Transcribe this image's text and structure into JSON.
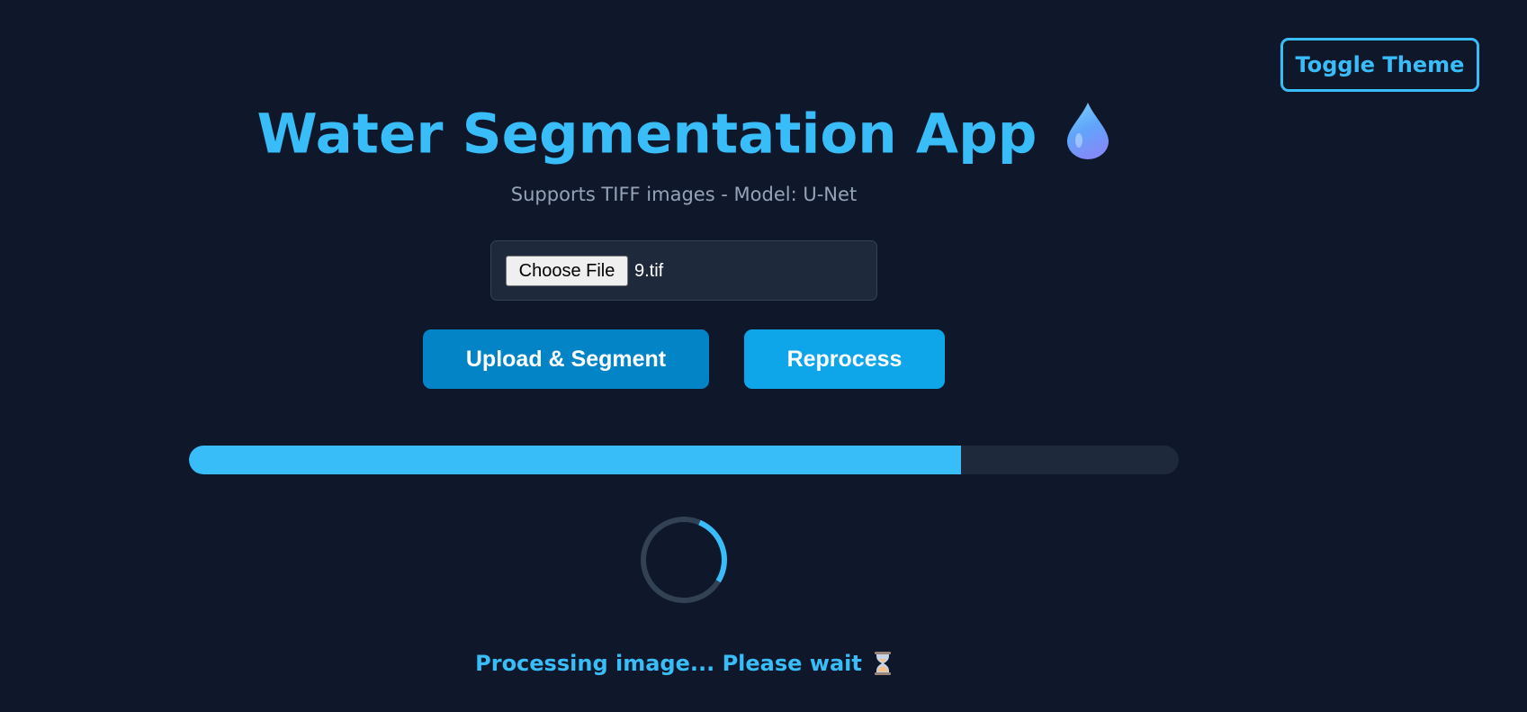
{
  "header": {
    "toggle_theme_label": "Toggle Theme"
  },
  "app": {
    "title": "Water Segmentation App",
    "title_icon": "water-drop-icon",
    "subtitle": "Supports TIFF images - Model: U-Net"
  },
  "file_input": {
    "button_label": "Choose File",
    "file_name": "9.tif"
  },
  "actions": {
    "upload_label": "Upload & Segment",
    "reprocess_label": "Reprocess"
  },
  "progress": {
    "fraction": 0.78
  },
  "status": {
    "text": "Processing image... Please wait",
    "icon": "hourglass-icon"
  },
  "colors": {
    "background": "#0f172a",
    "accent": "#38bdf8",
    "upload_button": "#0284c7",
    "reprocess_button": "#0ea5e9",
    "panel": "#1e293b",
    "muted_text": "#94a3b8"
  }
}
